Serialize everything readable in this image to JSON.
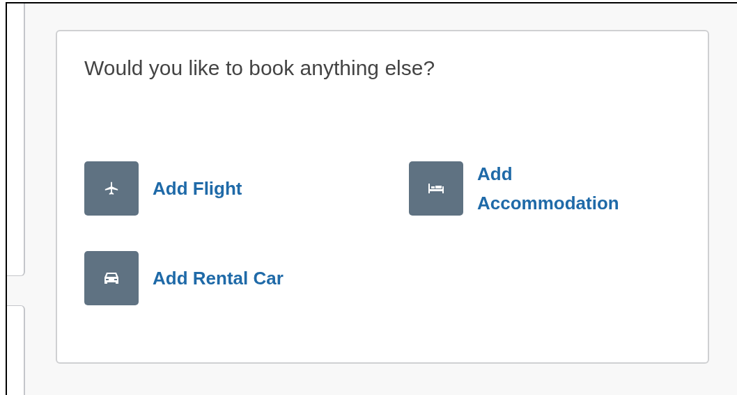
{
  "heading": "Would you like to book anything else?",
  "options": [
    {
      "kind": "flight",
      "label": "Add Flight"
    },
    {
      "kind": "accommodation",
      "label": "Add Accommodation"
    },
    {
      "kind": "car",
      "label": "Add Rental Car"
    }
  ]
}
